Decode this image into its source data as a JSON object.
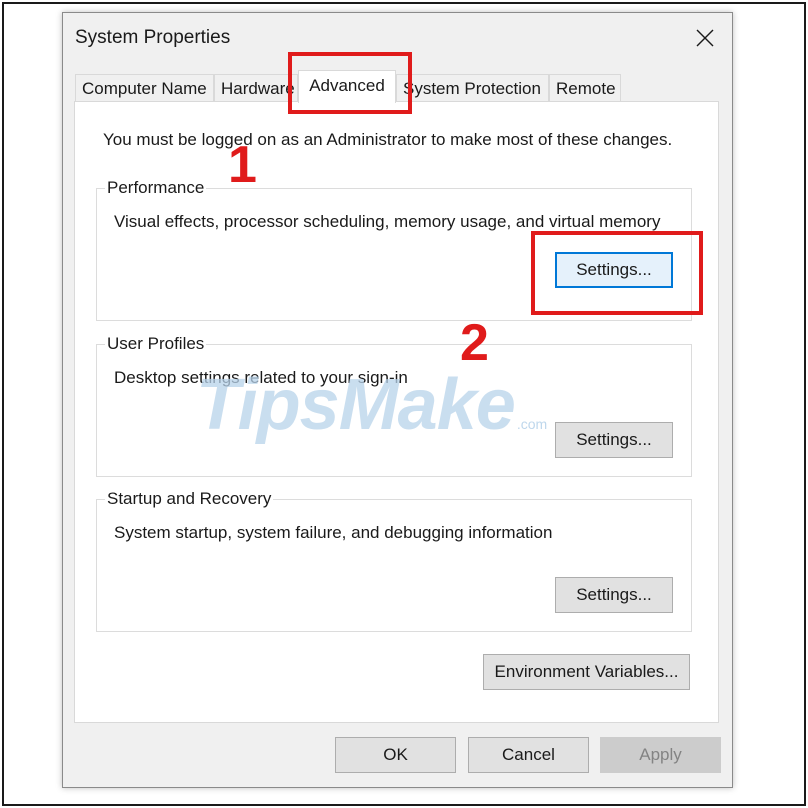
{
  "window": {
    "title": "System Properties"
  },
  "tabs": [
    {
      "label": "Computer Name"
    },
    {
      "label": "Hardware"
    },
    {
      "label": "Advanced"
    },
    {
      "label": "System Protection"
    },
    {
      "label": "Remote"
    }
  ],
  "active_tab": "Advanced",
  "panel": {
    "admin_note": "You must be logged on as an Administrator to make most of these changes.",
    "groups": [
      {
        "label": "Performance",
        "description": "Visual effects, processor scheduling, memory usage, and virtual memory",
        "button": "Settings..."
      },
      {
        "label": "User Profiles",
        "description": "Desktop settings related to your sign-in",
        "button": "Settings..."
      },
      {
        "label": "Startup and Recovery",
        "description": "System startup, system failure, and debugging information",
        "button": "Settings..."
      }
    ],
    "env_button": "Environment Variables..."
  },
  "footer": {
    "ok": "OK",
    "cancel": "Cancel",
    "apply": "Apply"
  },
  "annotations": {
    "step1": "1",
    "step2": "2",
    "color": "#e01b1b"
  },
  "watermark": {
    "brand": "TipsMake",
    "suffix": ".com"
  },
  "icons": {
    "close": "close-icon"
  }
}
